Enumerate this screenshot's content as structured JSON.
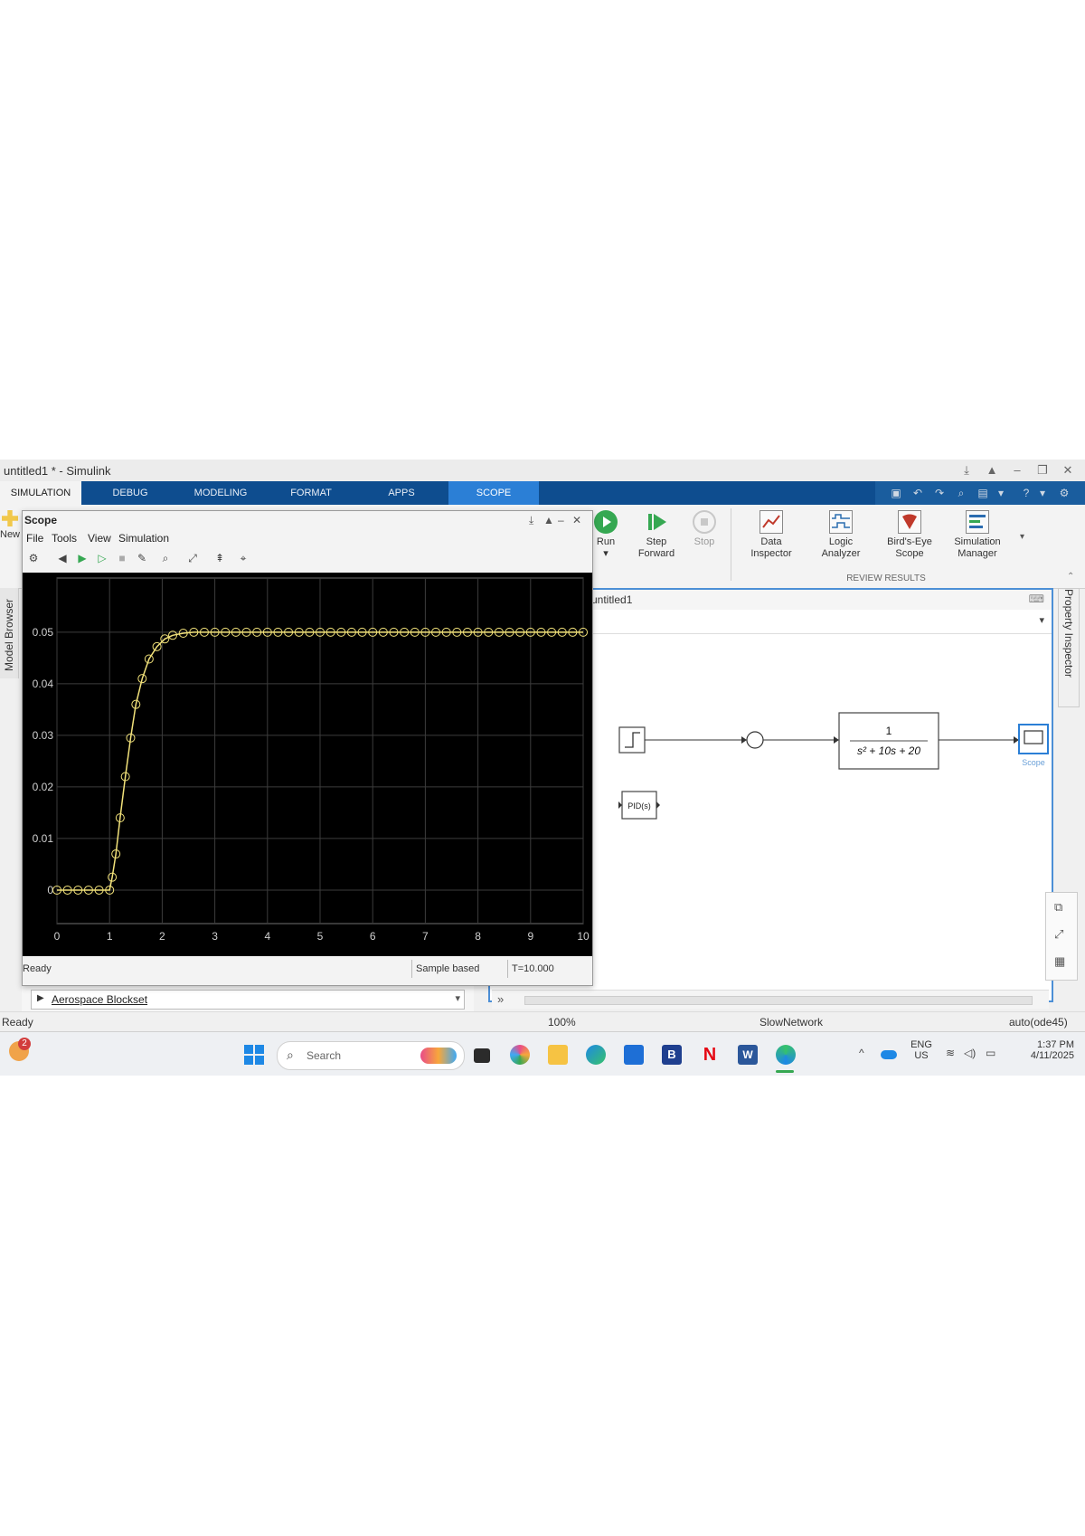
{
  "window": {
    "title": "untitled1 * - Simulink",
    "controls": [
      "⤓",
      "▲",
      "–",
      "❐",
      "✕"
    ]
  },
  "ribbon": {
    "tabs": [
      "SIMULATION",
      "DEBUG",
      "MODELING",
      "FORMAT",
      "APPS",
      "SCOPE"
    ],
    "new_label": "New",
    "run_label": "Run",
    "step_forward_label": [
      "Step",
      "Forward"
    ],
    "stop_label": "Stop",
    "review_buttons": [
      {
        "line1": "Data",
        "line2": "Inspector",
        "icon": "data-inspector-icon"
      },
      {
        "line1": "Logic",
        "line2": "Analyzer",
        "icon": "logic-analyzer-icon"
      },
      {
        "line1": "Bird's-Eye",
        "line2": "Scope",
        "icon": "birds-eye-scope-icon"
      },
      {
        "line1": "Simulation",
        "line2": "Manager",
        "icon": "simulation-manager-icon"
      }
    ],
    "review_section_label": "REVIEW RESULTS"
  },
  "left_panel": {
    "label": "Model Browser"
  },
  "right_panel": {
    "label": "Property Inspector"
  },
  "scope": {
    "title": "Scope",
    "menu": [
      "File",
      "Tools",
      "View",
      "Simulation"
    ],
    "status": {
      "left": "Ready",
      "mode": "Sample based",
      "time": "T=10.000"
    }
  },
  "chart_data": {
    "type": "line",
    "title": "",
    "xlabel": "",
    "ylabel": "",
    "xlim": [
      0,
      10
    ],
    "ylim": [
      -0.0065,
      0.0605
    ],
    "xticks": [
      0,
      1,
      2,
      3,
      4,
      5,
      6,
      7,
      8,
      9,
      10
    ],
    "yticks": [
      0,
      0.01,
      0.02,
      0.03,
      0.04,
      0.05
    ],
    "yticklabels": [
      "0",
      "0.01",
      "0.02",
      "0.03",
      "0.04",
      "0.05"
    ],
    "grid": true,
    "background": "#000000",
    "line_color": "#f2e27a",
    "marker": "circle",
    "series": [
      {
        "x": [
          0,
          0.2,
          0.4,
          0.6,
          0.8,
          1.0,
          1.05,
          1.12,
          1.2,
          1.3,
          1.4,
          1.5,
          1.62,
          1.75,
          1.9,
          2.05,
          2.2,
          2.4,
          2.6,
          2.8,
          3.0,
          3.2,
          3.4,
          3.6,
          3.8,
          4.0,
          4.2,
          4.4,
          4.6,
          4.8,
          5.0,
          5.2,
          5.4,
          5.6,
          5.8,
          6.0,
          6.2,
          6.4,
          6.6,
          6.8,
          7.0,
          7.2,
          7.4,
          7.6,
          7.8,
          8.0,
          8.2,
          8.4,
          8.6,
          8.8,
          9.0,
          9.2,
          9.4,
          9.6,
          9.8,
          10.0
        ],
        "y": [
          0,
          0,
          0,
          0,
          0,
          0,
          0.0025,
          0.007,
          0.014,
          0.022,
          0.0295,
          0.036,
          0.041,
          0.0448,
          0.0472,
          0.0487,
          0.0494,
          0.0498,
          0.05,
          0.05,
          0.05,
          0.05,
          0.05,
          0.05,
          0.05,
          0.05,
          0.05,
          0.05,
          0.05,
          0.05,
          0.05,
          0.05,
          0.05,
          0.05,
          0.05,
          0.05,
          0.05,
          0.05,
          0.05,
          0.05,
          0.05,
          0.05,
          0.05,
          0.05,
          0.05,
          0.05,
          0.05,
          0.05,
          0.05,
          0.05,
          0.05,
          0.05,
          0.05,
          0.05,
          0.05,
          0.05
        ]
      }
    ]
  },
  "model": {
    "tab_label": "untitled1",
    "blocks": {
      "transfer_fn_num": "1",
      "transfer_fn_den": "s² + 10s + 20",
      "pid_label": "PID(s)",
      "scope_label": "Scope"
    }
  },
  "library": {
    "item": "Aerospace Blockset"
  },
  "statusbar": {
    "left": "Ready",
    "zoom": "100%",
    "mode": "SlowNetwork",
    "solver": "auto(ode45)"
  },
  "taskbar": {
    "search_placeholder": "Search",
    "notification_count": "2",
    "lang": "ENG",
    "region": "US",
    "time": "1:37 PM",
    "date": "4/11/2025"
  }
}
